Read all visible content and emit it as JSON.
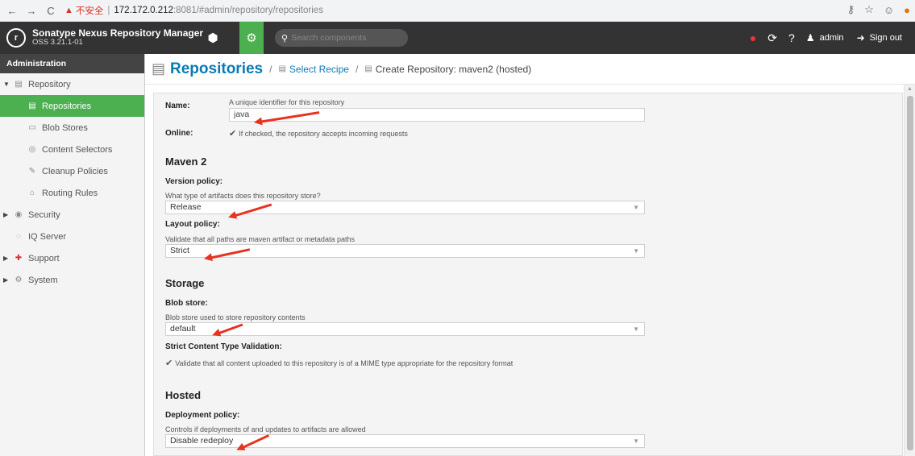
{
  "browser": {
    "back": "←",
    "forward": "→",
    "reload": "C",
    "insecure_label": "不安全",
    "url_host": "172.172.0.212",
    "url_rest": ":8081/#admin/repository/repositories"
  },
  "header": {
    "brand_name": "Sonatype Nexus Repository Manager",
    "version": "OSS 3.21.1-01",
    "search_placeholder": "Search components",
    "user": "admin",
    "sign_out": "Sign out"
  },
  "sidebar": {
    "title": "Administration",
    "items": [
      {
        "label": "Repository"
      },
      {
        "label": "Repositories"
      },
      {
        "label": "Blob Stores"
      },
      {
        "label": "Content Selectors"
      },
      {
        "label": "Cleanup Policies"
      },
      {
        "label": "Routing Rules"
      },
      {
        "label": "Security"
      },
      {
        "label": "IQ Server"
      },
      {
        "label": "Support"
      },
      {
        "label": "System"
      }
    ]
  },
  "breadcrumb": {
    "title": "Repositories",
    "link": "Select Recipe",
    "current": "Create Repository: maven2 (hosted)"
  },
  "form": {
    "name_label": "Name:",
    "name_hint": "A unique identifier for this repository",
    "name_value": "java",
    "online_label": "Online:",
    "online_hint": "If checked, the repository accepts incoming requests",
    "maven_heading": "Maven 2",
    "version_label": "Version policy:",
    "version_hint": "What type of artifacts does this repository store?",
    "version_value": "Release",
    "layout_label": "Layout policy:",
    "layout_hint": "Validate that all paths are maven artifact or metadata paths",
    "layout_value": "Strict",
    "storage_heading": "Storage",
    "blob_label": "Blob store:",
    "blob_hint": "Blob store used to store repository contents",
    "blob_value": "default",
    "strict_label": "Strict Content Type Validation:",
    "strict_hint": "Validate that all content uploaded to this repository is of a MIME type appropriate for the repository format",
    "hosted_heading": "Hosted",
    "deploy_label": "Deployment policy:",
    "deploy_hint": "Controls if deployments of and updates to artifacts are allowed",
    "deploy_value": "Disable redeploy"
  },
  "colors": {
    "accent_green": "#4caf50",
    "link_blue": "#0a7ab5",
    "header_dark": "#333333",
    "annotation_red": "#e8321f"
  }
}
